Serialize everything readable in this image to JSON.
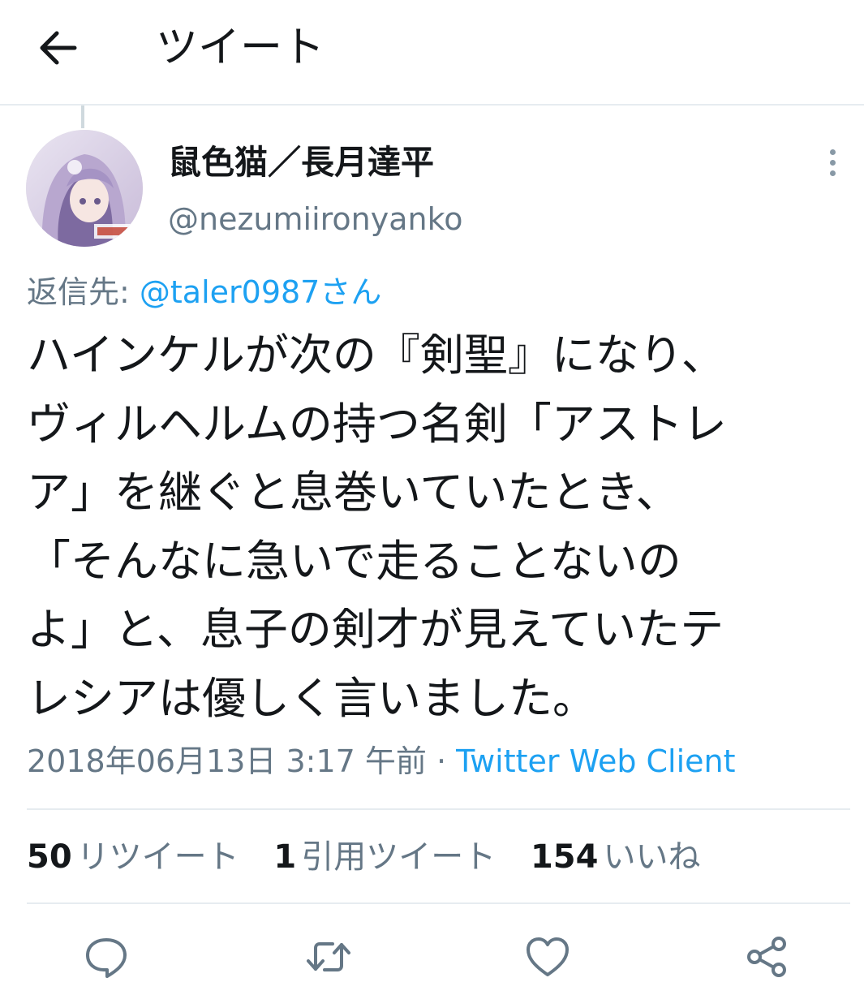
{
  "header": {
    "title": "ツイート"
  },
  "author": {
    "name": "鼠色猫／長月達平",
    "handle": "@nezumiironyanko"
  },
  "reply": {
    "prefix": "返信先: ",
    "mention": "@taler0987さん"
  },
  "tweet": {
    "lines": [
      "ハインケルが次の『剣聖』になり、",
      "ヴィルヘルムの持つ名剣「アストレ",
      "ア」を継ぐと息巻いていたとき、",
      "「そんなに急いで走ることないの",
      "よ」と、息子の剣才が見えていたテ",
      "レシアは優しく言いました。"
    ]
  },
  "meta": {
    "timestamp": "2018年06月13日 3:17 午前",
    "separator": " · ",
    "client": "Twitter Web Client"
  },
  "stats": {
    "retweets": {
      "count": "50",
      "label": "リツイート"
    },
    "quotes": {
      "count": "1",
      "label": "引用ツイート"
    },
    "likes": {
      "count": "154",
      "label": "いいね"
    }
  },
  "actions": {
    "icons": [
      "reply-icon",
      "retweet-icon",
      "like-icon",
      "share-icon"
    ]
  },
  "colors": {
    "accent": "#1da1f2",
    "secondary_text": "#657786",
    "primary_text": "#14171a",
    "icon": "#657786"
  }
}
